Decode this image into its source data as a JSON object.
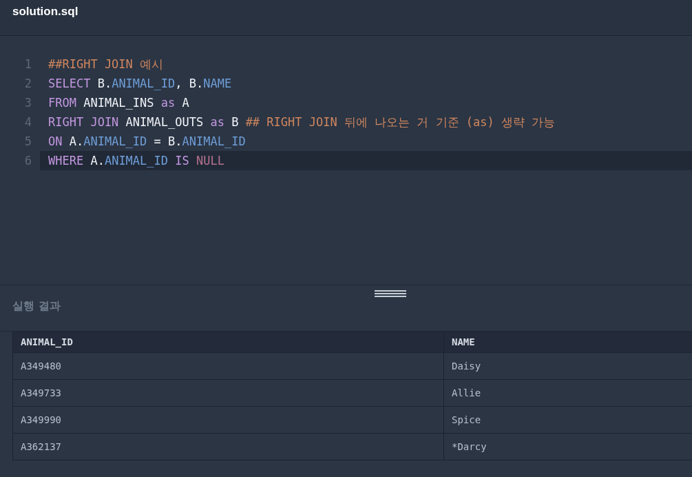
{
  "editor": {
    "filename": "solution.sql",
    "lines": [
      {
        "number": "1",
        "active": false,
        "tokens": [
          {
            "kind": "comment",
            "text": "##RIGHT JOIN 예시"
          }
        ]
      },
      {
        "number": "2",
        "active": false,
        "tokens": [
          {
            "kind": "keyword",
            "text": "SELECT"
          },
          {
            "kind": "plain",
            "text": " B."
          },
          {
            "kind": "field",
            "text": "ANIMAL_ID"
          },
          {
            "kind": "plain",
            "text": ", B."
          },
          {
            "kind": "field",
            "text": "NAME"
          }
        ]
      },
      {
        "number": "3",
        "active": false,
        "tokens": [
          {
            "kind": "keyword",
            "text": "FROM"
          },
          {
            "kind": "plain",
            "text": " ANIMAL_INS "
          },
          {
            "kind": "keyword",
            "text": "as"
          },
          {
            "kind": "plain",
            "text": " A"
          }
        ]
      },
      {
        "number": "4",
        "active": false,
        "tokens": [
          {
            "kind": "keyword",
            "text": "RIGHT JOIN"
          },
          {
            "kind": "plain",
            "text": " ANIMAL_OUTS "
          },
          {
            "kind": "keyword",
            "text": "as"
          },
          {
            "kind": "plain",
            "text": " B "
          },
          {
            "kind": "comment",
            "text": "## RIGHT JOIN 뒤에 나오는 거 기준 (as) 생략 가능"
          }
        ]
      },
      {
        "number": "5",
        "active": false,
        "tokens": [
          {
            "kind": "keyword",
            "text": "ON"
          },
          {
            "kind": "plain",
            "text": " A."
          },
          {
            "kind": "field",
            "text": "ANIMAL_ID"
          },
          {
            "kind": "plain",
            "text": " = B."
          },
          {
            "kind": "field",
            "text": "ANIMAL_ID"
          }
        ]
      },
      {
        "number": "6",
        "active": true,
        "tokens": [
          {
            "kind": "keyword",
            "text": "WHERE"
          },
          {
            "kind": "plain",
            "text": " A."
          },
          {
            "kind": "field",
            "text": "ANIMAL_ID"
          },
          {
            "kind": "keyword",
            "text": " IS "
          },
          {
            "kind": "null",
            "text": "NULL"
          }
        ]
      }
    ]
  },
  "results": {
    "title": "실행 결과",
    "table": {
      "columns": [
        "ANIMAL_ID",
        "NAME"
      ],
      "rows": [
        [
          "A349480",
          "Daisy"
        ],
        [
          "A349733",
          "Allie"
        ],
        [
          "A349990",
          "Spice"
        ],
        [
          "A362137",
          "*Darcy"
        ]
      ]
    }
  }
}
